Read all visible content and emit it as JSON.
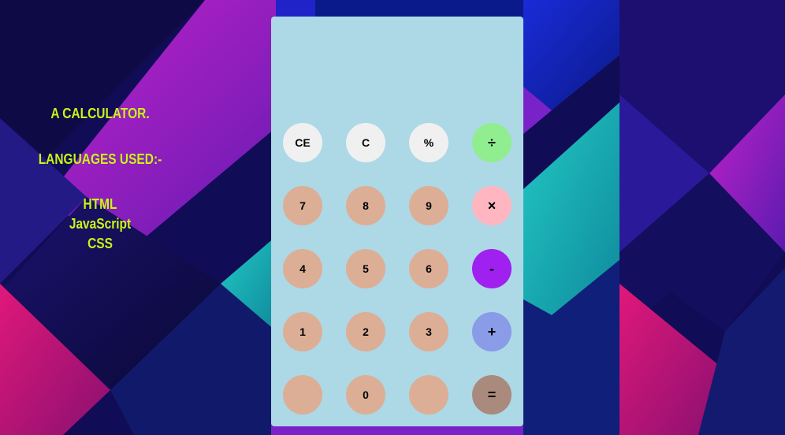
{
  "side_panel": {
    "title": "A CALCULATOR.",
    "languages_heading": "LANGUAGES USED:-",
    "languages": [
      "HTML",
      "JavaScript",
      "CSS"
    ]
  },
  "calculator": {
    "display_value": "",
    "buttons": [
      {
        "name": "clear-entry-button",
        "label": "CE",
        "color": "#f0f0f0"
      },
      {
        "name": "clear-button",
        "label": "C",
        "color": "#f0f0f0"
      },
      {
        "name": "percent-button",
        "label": "%",
        "color": "#f0f0f0"
      },
      {
        "name": "divide-button",
        "label": "÷",
        "color": "#90ee90"
      },
      {
        "name": "digit-7-button",
        "label": "7",
        "color": "#dcae96"
      },
      {
        "name": "digit-8-button",
        "label": "8",
        "color": "#dcae96"
      },
      {
        "name": "digit-9-button",
        "label": "9",
        "color": "#dcae96"
      },
      {
        "name": "multiply-button",
        "label": "×",
        "color": "#ffb6c1"
      },
      {
        "name": "digit-4-button",
        "label": "4",
        "color": "#dcae96"
      },
      {
        "name": "digit-5-button",
        "label": "5",
        "color": "#dcae96"
      },
      {
        "name": "digit-6-button",
        "label": "6",
        "color": "#dcae96"
      },
      {
        "name": "subtract-button",
        "label": "-",
        "color": "#a020f0"
      },
      {
        "name": "digit-1-button",
        "label": "1",
        "color": "#dcae96"
      },
      {
        "name": "digit-2-button",
        "label": "2",
        "color": "#dcae96"
      },
      {
        "name": "digit-3-button",
        "label": "3",
        "color": "#dcae96"
      },
      {
        "name": "add-button",
        "label": "+",
        "color": "#8a9be8"
      },
      {
        "name": "blank-button-left",
        "label": "",
        "color": "#dcae96"
      },
      {
        "name": "digit-0-button",
        "label": "0",
        "color": "#dcae96"
      },
      {
        "name": "blank-button-right",
        "label": "",
        "color": "#dcae96"
      },
      {
        "name": "equals-button",
        "label": "=",
        "color": "#a98a7c"
      }
    ]
  },
  "colors": {
    "panel_background": "#add8e6",
    "side_text": "#c8f51a"
  }
}
